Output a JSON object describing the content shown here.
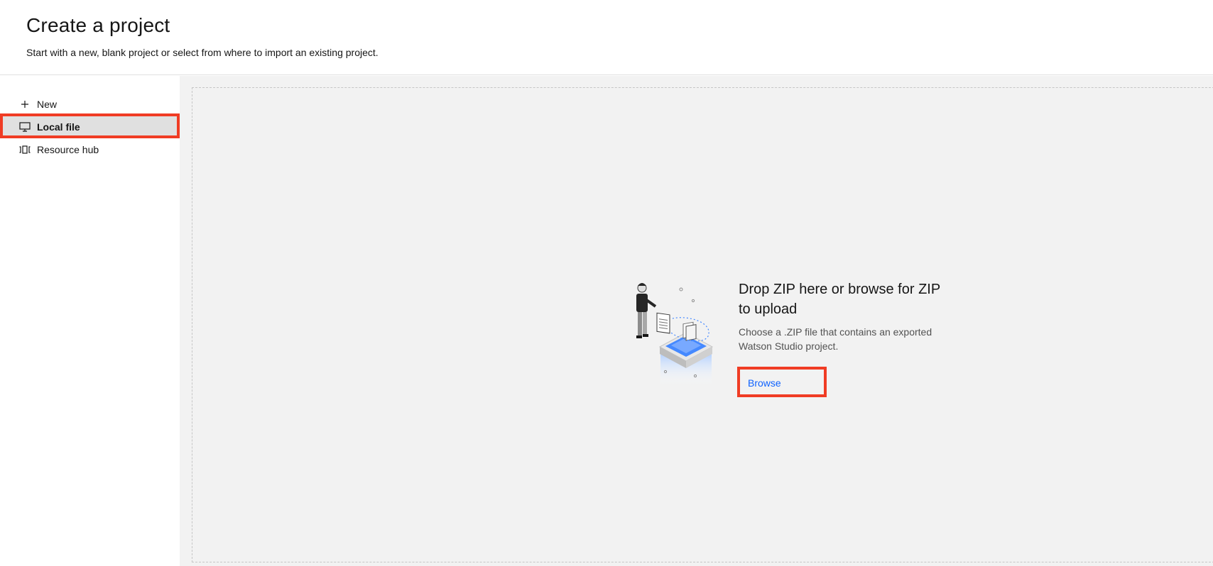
{
  "header": {
    "title": "Create a project",
    "subtitle": "Start with a new, blank project or select from where to import an existing project."
  },
  "sidebar": {
    "items": [
      {
        "label": "New",
        "icon": "plus-icon"
      },
      {
        "label": "Local file",
        "icon": "monitor-icon",
        "selected": true
      },
      {
        "label": "Resource hub",
        "icon": "resource-hub-icon"
      }
    ]
  },
  "dropzone": {
    "title": "Drop ZIP here or browse for ZIP to upload",
    "description": "Choose a .ZIP file that contains an exported Watson Studio project.",
    "browse_label": "Browse",
    "illustration": "upload-illustration"
  },
  "colors": {
    "highlight": "#f03c24",
    "link": "#0f62fe",
    "selected_bg": "#e0e0e0",
    "main_bg": "#f2f2f2"
  }
}
